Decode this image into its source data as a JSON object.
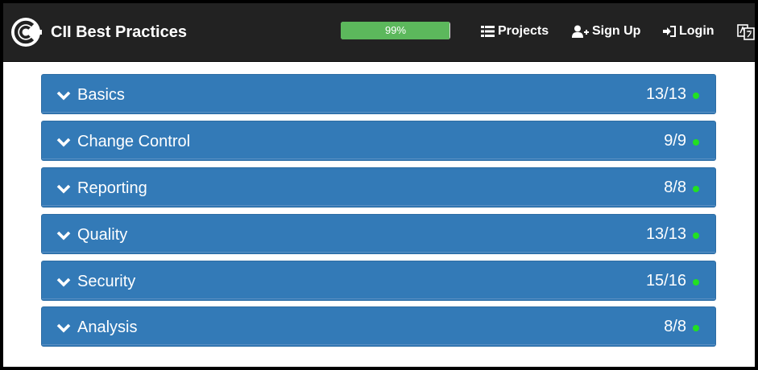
{
  "brand": {
    "title": "CII Best Practices"
  },
  "progress": {
    "value": 0.99,
    "label": "99%",
    "color": "#5cb85c"
  },
  "nav": {
    "projects": "Projects",
    "signup": "Sign Up",
    "login": "Login"
  },
  "sections": [
    {
      "title": "Basics",
      "count": "13/13",
      "status": "passing"
    },
    {
      "title": "Change Control",
      "count": "9/9",
      "status": "passing"
    },
    {
      "title": "Reporting",
      "count": "8/8",
      "status": "passing"
    },
    {
      "title": "Quality",
      "count": "13/13",
      "status": "passing"
    },
    {
      "title": "Security",
      "count": "15/16",
      "status": "passing"
    },
    {
      "title": "Analysis",
      "count": "8/8",
      "status": "passing"
    }
  ],
  "colors": {
    "navbar": "#222222",
    "panel": "#337ab7",
    "status_dot": "#22e022"
  }
}
